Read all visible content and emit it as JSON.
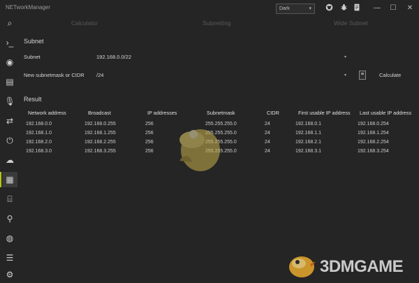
{
  "app": {
    "title": "NETworkManager"
  },
  "titlebar": {
    "theme_value": "Dark",
    "icons": [
      "github-icon",
      "bug-icon",
      "document-icon"
    ],
    "window_controls": {
      "minimize": "—",
      "maximize": "☐",
      "close": "✕"
    }
  },
  "sidebar": {
    "items": [
      {
        "icon": "search-icon",
        "glyph": "⌕"
      },
      {
        "icon": "terminal-icon",
        "glyph": "›_"
      },
      {
        "icon": "eye-icon",
        "glyph": "◉"
      },
      {
        "icon": "network-card-icon",
        "glyph": "▤"
      },
      {
        "icon": "microphone-icon",
        "glyph": "🎙"
      },
      {
        "icon": "transfer-icon",
        "glyph": "⇄"
      },
      {
        "icon": "power-icon",
        "glyph": "⏻"
      },
      {
        "icon": "cloud-icon",
        "glyph": "☁"
      },
      {
        "icon": "calculator-icon",
        "glyph": "▦",
        "active": true
      },
      {
        "icon": "lookup-icon",
        "glyph": "⌸"
      },
      {
        "icon": "satellite-icon",
        "glyph": "⚲"
      },
      {
        "icon": "globe-icon",
        "glyph": "◍"
      },
      {
        "icon": "list-icon",
        "glyph": "☰"
      },
      {
        "icon": "settings-icon",
        "glyph": "⚙"
      }
    ]
  },
  "tabs": [
    "Calculator",
    "Subnetting",
    "Wide Subnet"
  ],
  "subnet": {
    "title": "Subnet",
    "subnet_label": "Subnet",
    "subnet_value": "192.168.0.0/22",
    "mask_label": "New subnetmask or CIDR",
    "mask_value": "/24",
    "calculate_label": "Calculate"
  },
  "result": {
    "title": "Result",
    "columns": [
      "Network address",
      "Broadcast",
      "IP addresses",
      "Subnetmask",
      "CIDR",
      "First usable IP address",
      "Last usable IP address"
    ],
    "rows": [
      [
        "192.168.0.0",
        "192.168.0.255",
        "256",
        "255.255.255.0",
        "24",
        "192.168.0.1",
        "192.168.0.254"
      ],
      [
        "192.168.1.0",
        "192.168.1.255",
        "256",
        "255.255.255.0",
        "24",
        "192.168.1.1",
        "192.168.1.254"
      ],
      [
        "192.168.2.0",
        "192.168.2.255",
        "256",
        "255.255.255.0",
        "24",
        "192.168.2.1",
        "192.168.2.254"
      ],
      [
        "192.168.3.0",
        "192.168.3.255",
        "256",
        "255.255.255.0",
        "24",
        "192.168.3.1",
        "192.168.3.254"
      ]
    ]
  },
  "watermark": {
    "text": "3DMGAME"
  }
}
